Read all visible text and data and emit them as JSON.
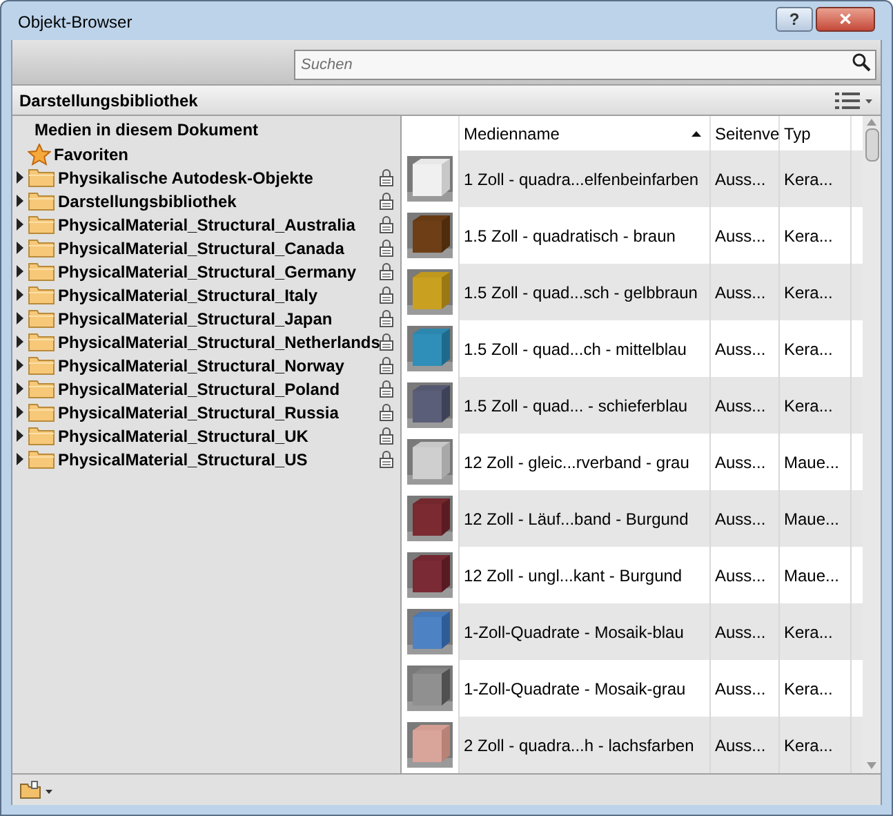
{
  "window": {
    "title": "Objekt-Browser",
    "buttons": [
      "?",
      "✕"
    ]
  },
  "search": {
    "placeholder": "Suchen"
  },
  "section": {
    "title": "Darstellungsbibliothek"
  },
  "tree": {
    "heading": "Medien in diesem Dokument",
    "items": [
      {
        "kind": "favorite",
        "label": "Favoriten"
      },
      {
        "kind": "folder",
        "label": "Physikalische Autodesk-Objekte",
        "expanded": false,
        "locked": true
      },
      {
        "kind": "folder",
        "label": "Darstellungsbibliothek",
        "expanded": false,
        "locked": true
      },
      {
        "kind": "folder",
        "label": "PhysicalMaterial_Structural_Australia",
        "expanded": false,
        "locked": true
      },
      {
        "kind": "folder",
        "label": "PhysicalMaterial_Structural_Canada",
        "expanded": false,
        "locked": true
      },
      {
        "kind": "folder",
        "label": "PhysicalMaterial_Structural_Germany",
        "expanded": false,
        "locked": true
      },
      {
        "kind": "folder",
        "label": "PhysicalMaterial_Structural_Italy",
        "expanded": false,
        "locked": true
      },
      {
        "kind": "folder",
        "label": "PhysicalMaterial_Structural_Japan",
        "expanded": false,
        "locked": true
      },
      {
        "kind": "folder",
        "label": "PhysicalMaterial_Structural_Netherlands",
        "expanded": false,
        "locked": true
      },
      {
        "kind": "folder",
        "label": "PhysicalMaterial_Structural_Norway",
        "expanded": false,
        "locked": true
      },
      {
        "kind": "folder",
        "label": "PhysicalMaterial_Structural_Poland",
        "expanded": false,
        "locked": true
      },
      {
        "kind": "folder",
        "label": "PhysicalMaterial_Structural_Russia",
        "expanded": false,
        "locked": true
      },
      {
        "kind": "folder",
        "label": "PhysicalMaterial_Structural_UK",
        "expanded": false,
        "locked": true
      },
      {
        "kind": "folder",
        "label": "PhysicalMaterial_Structural_US",
        "expanded": false,
        "locked": true
      }
    ]
  },
  "table": {
    "columns": [
      {
        "label": "Medienname",
        "sorted": true
      },
      {
        "label": "Seitenve"
      },
      {
        "label": "Typ"
      }
    ],
    "rows": [
      {
        "cells": [
          "1 Zoll - quadra...elfenbeinfarben",
          "Auss...",
          "Kera..."
        ]
      },
      {
        "cells": [
          "1.5 Zoll - quadratisch - braun",
          "Auss...",
          "Kera..."
        ]
      },
      {
        "cells": [
          "1.5 Zoll - quad...sch - gelbbraun",
          "Auss...",
          "Kera..."
        ]
      },
      {
        "cells": [
          "1.5 Zoll - quad...ch - mittelblau",
          "Auss...",
          "Kera..."
        ]
      },
      {
        "cells": [
          "1.5 Zoll - quad... - schieferblau",
          "Auss...",
          "Kera..."
        ]
      },
      {
        "cells": [
          "12 Zoll - gleic...rverband - grau",
          "Auss...",
          "Maue..."
        ]
      },
      {
        "cells": [
          "12 Zoll - Läuf...band - Burgund",
          "Auss...",
          "Maue..."
        ]
      },
      {
        "cells": [
          "12 Zoll - ungl...kant - Burgund",
          "Auss...",
          "Maue..."
        ]
      },
      {
        "cells": [
          "1-Zoll-Quadrate - Mosaik-blau",
          "Auss...",
          "Kera..."
        ]
      },
      {
        "cells": [
          "1-Zoll-Quadrate - Mosaik-grau",
          "Auss...",
          "Kera..."
        ]
      },
      {
        "cells": [
          "2 Zoll - quadra...h - lachsfarben",
          "Auss...",
          "Kera..."
        ]
      }
    ]
  }
}
